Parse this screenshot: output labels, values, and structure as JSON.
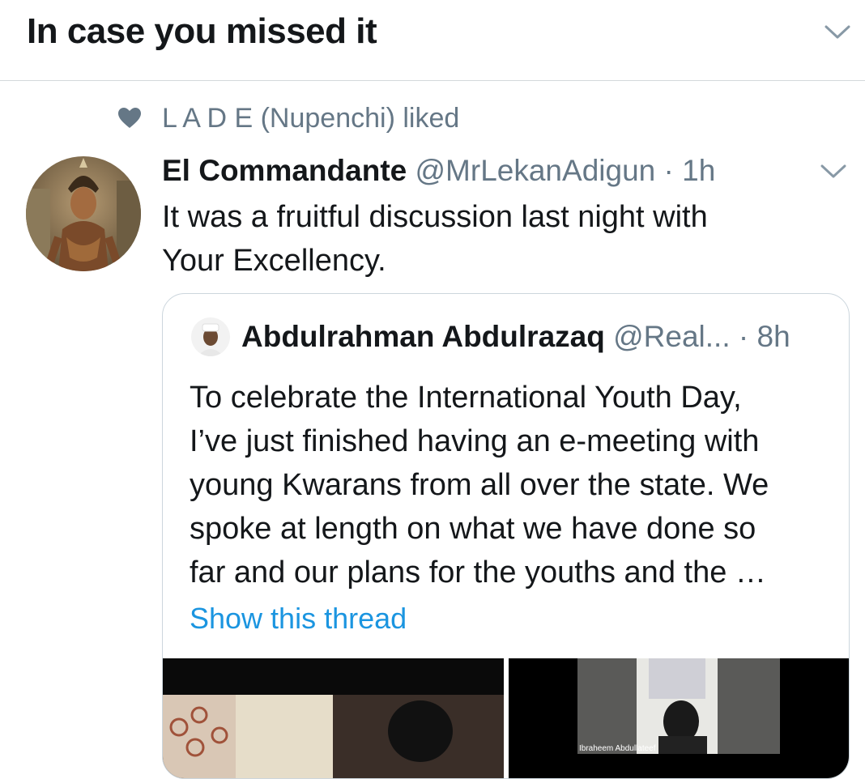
{
  "header": {
    "title": "In case you missed it",
    "dropdown_icon": "chevron-down-icon"
  },
  "social_context": {
    "icon": "heart-icon",
    "text": "L A D E (Nupenchi) liked"
  },
  "tweet": {
    "name": "El Commandante",
    "handle": "@MrLekanAdigun",
    "separator": "·",
    "time": "1h",
    "text_line1": "It was a fruitful discussion last night with",
    "text_line2": "Your Excellency.",
    "menu_icon": "chevron-down-icon",
    "quoted": {
      "name": "Abdulrahman Abdulrazaq",
      "handle": "@Real...",
      "separator": "·",
      "time": "8h",
      "lines": [
        "To celebrate the International Youth Day,",
        "I’ve just finished having an e-meeting with",
        "young Kwarans from all over the state. We",
        "spoke at length on what we have done so",
        "far and our plans for the youths and the …"
      ],
      "show_thread": "Show this thread",
      "media_label": "Ibraheem Abdullateef"
    }
  },
  "colors": {
    "link": "#1b95e0",
    "secondary": "#657786",
    "border": "#ccd6dd"
  }
}
